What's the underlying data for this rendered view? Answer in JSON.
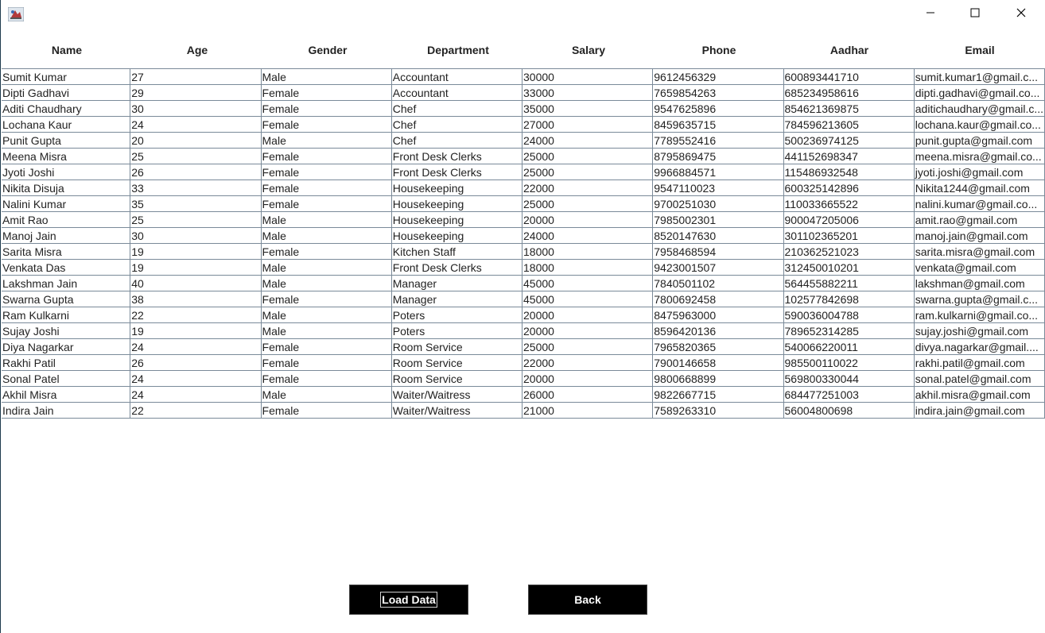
{
  "window": {
    "icon": "java-cup-icon",
    "minimize_icon": "minimize-icon",
    "maximize_icon": "maximize-icon",
    "close_icon": "close-icon"
  },
  "table": {
    "headers": [
      "Name",
      "Age",
      "Gender",
      "Department",
      "Salary",
      "Phone",
      "Aadhar",
      "Email"
    ],
    "rows": [
      [
        "Sumit Kumar",
        "27",
        "Male",
        "Accountant",
        "30000",
        "9612456329",
        "600893441710",
        "sumit.kumar1@gmail.c..."
      ],
      [
        "Dipti Gadhavi",
        "29",
        "Female",
        "Accountant",
        "33000",
        "7659854263",
        "685234958616",
        "dipti.gadhavi@gmail.co..."
      ],
      [
        "Aditi Chaudhary",
        "30",
        "Female",
        "Chef",
        "35000",
        "9547625896",
        "854621369875",
        "aditichaudhary@gmail.c..."
      ],
      [
        "Lochana Kaur",
        "24",
        "Female",
        "Chef",
        "27000",
        "8459635715",
        "784596213605",
        "lochana.kaur@gmail.co..."
      ],
      [
        "Punit Gupta",
        "20",
        "Male",
        "Chef",
        "24000",
        "7789552416",
        "500236974125",
        "punit.gupta@gmail.com"
      ],
      [
        "Meena Misra",
        "25",
        "Female",
        "Front Desk Clerks",
        "25000",
        "8795869475",
        "441152698347",
        "meena.misra@gmail.co..."
      ],
      [
        "Jyoti Joshi",
        "26",
        "Female",
        "Front Desk Clerks",
        "25000",
        "9966884571",
        "115486932548",
        "jyoti.joshi@gmail.com"
      ],
      [
        "Nikita Disuja",
        "33",
        "Female",
        "Housekeeping",
        "22000",
        "9547110023",
        "600325142896",
        "Nikita1244@gmail.com"
      ],
      [
        "Nalini Kumar",
        "35",
        "Female",
        "Housekeeping",
        "25000",
        "9700251030",
        "110033665522",
        "nalini.kumar@gmail.co..."
      ],
      [
        "Amit Rao",
        "25",
        "Male",
        "Housekeeping",
        "20000",
        "7985002301",
        "900047205006",
        "amit.rao@gmail.com"
      ],
      [
        "Manoj Jain",
        "30",
        "Male",
        "Housekeeping",
        "24000",
        "8520147630",
        "301102365201",
        "manoj.jain@gmail.com"
      ],
      [
        "Sarita Misra",
        "19",
        "Female",
        "Kitchen Staff",
        "18000",
        "7958468594",
        "210362521023",
        "sarita.misra@gmail.com"
      ],
      [
        "Venkata Das",
        "19",
        "Male",
        "Front Desk Clerks",
        "18000",
        "9423001507",
        "312450010201",
        "venkata@gmail.com"
      ],
      [
        "Lakshman Jain",
        "40",
        "Male",
        "Manager",
        "45000",
        "7840501102",
        "564455882211",
        "lakshman@gmail.com"
      ],
      [
        "Swarna Gupta",
        "38",
        "Female",
        "Manager",
        "45000",
        "7800692458",
        "102577842698",
        "swarna.gupta@gmail.c..."
      ],
      [
        "Ram Kulkarni",
        "22",
        "Male",
        "Poters",
        "20000",
        "8475963000",
        "590036004788",
        "ram.kulkarni@gmail.co..."
      ],
      [
        "Sujay Joshi",
        "19",
        "Male",
        "Poters",
        "20000",
        "8596420136",
        "789652314285",
        "sujay.joshi@gmail.com"
      ],
      [
        "Diya Nagarkar",
        "24",
        "Female",
        "Room Service",
        "25000",
        "7965820365",
        "540066220011",
        "divya.nagarkar@gmail...."
      ],
      [
        "Rakhi Patil",
        "26",
        "Female",
        "Room Service",
        "22000",
        "7900146658",
        "985500110022",
        "rakhi.patil@gmail.com"
      ],
      [
        "Sonal Patel",
        "24",
        "Female",
        "Room Service",
        "20000",
        "9800668899",
        "569800330044",
        "sonal.patel@gmail.com"
      ],
      [
        "Akhil Misra",
        "24",
        "Male",
        "Waiter/Waitress",
        "26000",
        "9822667715",
        "684477251003",
        "akhil.misra@gmail.com"
      ],
      [
        "Indira Jain",
        "22",
        "Female",
        "Waiter/Waitress",
        "21000",
        "7589263310",
        "56004800698",
        "indira.jain@gmail.com"
      ]
    ]
  },
  "buttons": {
    "load_label": "Load Data",
    "back_label": "Back"
  },
  "colors": {
    "button_bg": "#000000",
    "button_text": "#ffffff",
    "grid_line": "#7a8a99"
  }
}
